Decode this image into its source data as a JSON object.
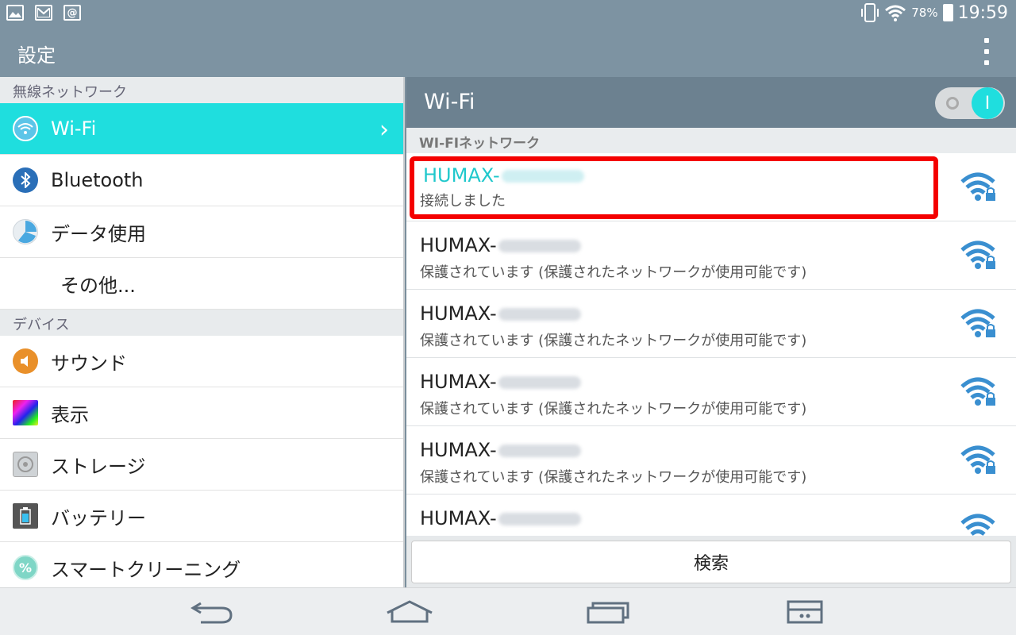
{
  "statusbar": {
    "battery_percent": "78%",
    "time": "19:59",
    "left_icons": [
      "image-icon",
      "gmail-icon",
      "at-icon"
    ]
  },
  "actionbar": {
    "title": "設定"
  },
  "left": {
    "section_wireless": "無線ネットワーク",
    "section_device": "デバイス",
    "items": [
      {
        "label": "Wi-Fi",
        "icon": "wifi-icon",
        "active": true
      },
      {
        "label": "Bluetooth",
        "icon": "bluetooth-icon"
      },
      {
        "label": "データ使用",
        "icon": "data-usage-icon"
      },
      {
        "label": "その他..."
      },
      {
        "label": "サウンド",
        "icon": "sound-icon"
      },
      {
        "label": "表示",
        "icon": "display-icon"
      },
      {
        "label": "ストレージ",
        "icon": "storage-icon"
      },
      {
        "label": "バッテリー",
        "icon": "battery-icon"
      },
      {
        "label": "スマートクリーニング",
        "icon": "smart-cleaning-icon"
      }
    ]
  },
  "right": {
    "title": "Wi-Fi",
    "toggle_on_label": "I",
    "list_header": "WI-FIネットワーク",
    "networks": [
      {
        "ssid": "HUMAX-",
        "status": "接続しました",
        "connected": true
      },
      {
        "ssid": "HUMAX-",
        "status": "保護されています (保護されたネットワークが使用可能です)"
      },
      {
        "ssid": "HUMAX-",
        "status": "保護されています (保護されたネットワークが使用可能です)"
      },
      {
        "ssid": "HUMAX-",
        "status": "保護されています (保護されたネットワークが使用可能です)"
      },
      {
        "ssid": "HUMAX-",
        "status": "保護されています (保護されたネットワークが使用可能です)"
      },
      {
        "ssid": "HUMAX-",
        "status": ""
      }
    ],
    "search_label": "検索"
  },
  "colors": {
    "accent": "#1fdede",
    "header": "#7d93a2",
    "highlight": "#f40000"
  }
}
